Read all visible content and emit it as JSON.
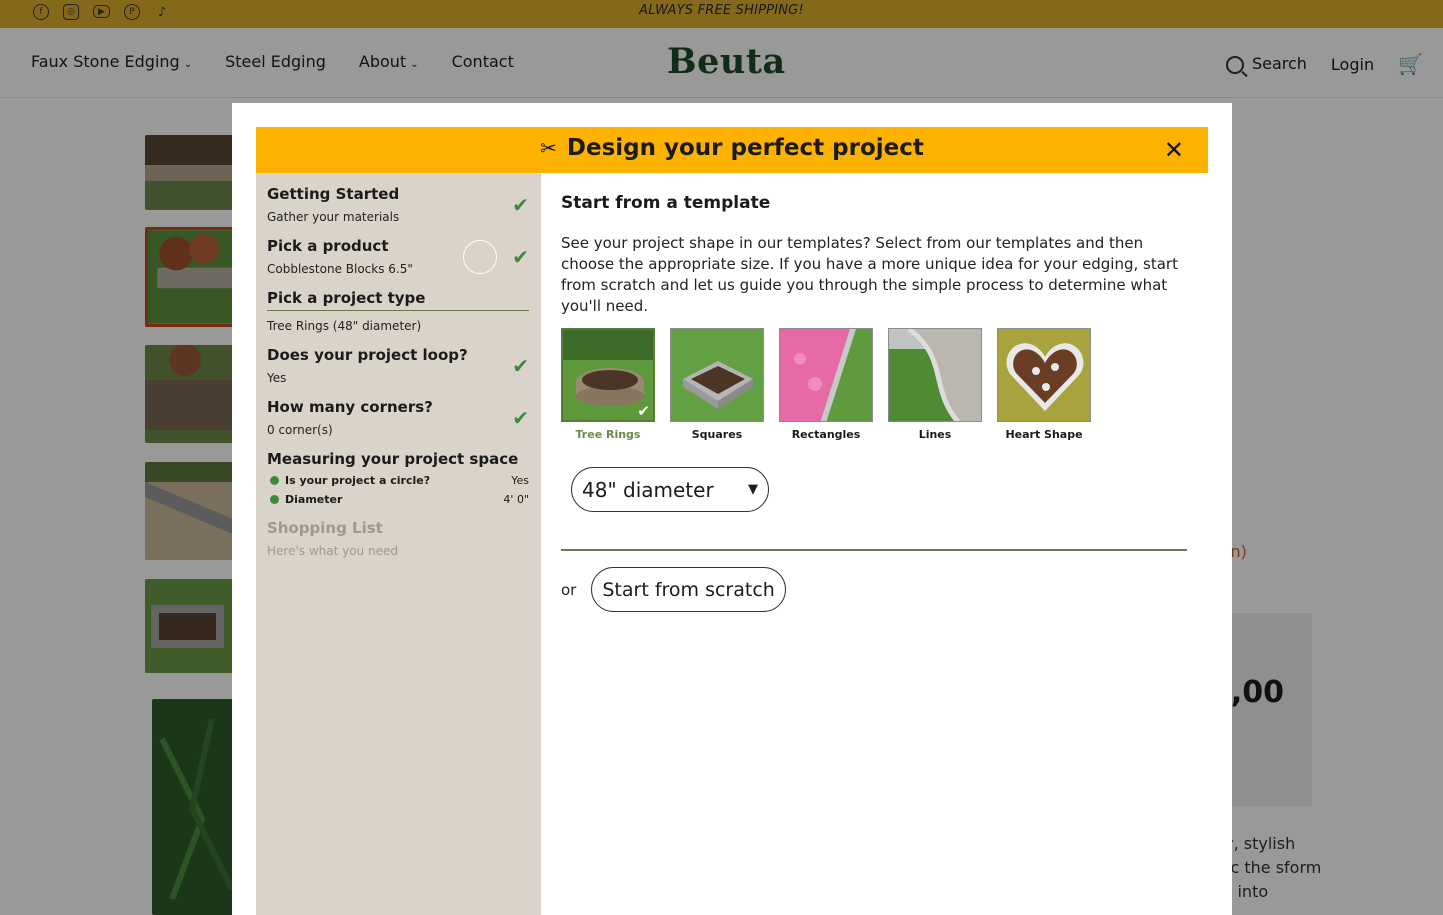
{
  "topbar": {
    "shipping": "ALWAYS FREE SHIPPING!",
    "social_icons": [
      "facebook-icon",
      "instagram-icon",
      "youtube-icon",
      "pinterest-icon",
      "tiktok-icon"
    ]
  },
  "header": {
    "nav": [
      {
        "label": "Faux Stone Edging",
        "has_menu": true
      },
      {
        "label": "Steel Edging",
        "has_menu": false
      },
      {
        "label": "About",
        "has_menu": true
      },
      {
        "label": "Contact",
        "has_menu": false
      }
    ],
    "logo": "Beuta",
    "search_label": "Search",
    "login_label": "Login"
  },
  "background": {
    "link_fragment": "in)",
    "price_fragment": ",00",
    "text_fragment": "asy, stylish imic the sform cks into"
  },
  "modal": {
    "title": "Design your perfect project",
    "close_label": "✕",
    "steps": [
      {
        "title": "Getting Started",
        "value": "Gather your materials",
        "done": true
      },
      {
        "title": "Pick a product",
        "value": "Cobblestone Blocks 6.5\"",
        "done": true
      },
      {
        "title": "Pick a project type",
        "value": "Tree Rings (48\" diameter)",
        "active": true
      },
      {
        "title": "Does your project loop?",
        "value": "Yes",
        "done": true
      },
      {
        "title": "How many corners?",
        "value": "0 corner(s)",
        "done": true
      },
      {
        "title": "Measuring your project space",
        "sub": [
          {
            "label": "Is your project a circle?",
            "value": "Yes"
          },
          {
            "label": "Diameter",
            "value": "4' 0\""
          }
        ]
      },
      {
        "title": "Shopping List",
        "value": "Here's what you need",
        "disabled": true
      }
    ],
    "content": {
      "heading": "Start from a template",
      "description": "See your project shape in our templates? Select from our templates and then choose the appropriate size. If you have a more unique idea for your edging, start from scratch and let us guide you through the simple process to determine what you'll need.",
      "templates": [
        {
          "label": "Tree Rings",
          "selected": true
        },
        {
          "label": "Squares"
        },
        {
          "label": "Rectangles"
        },
        {
          "label": "Lines"
        },
        {
          "label": "Heart Shape"
        }
      ],
      "size_value": "48\" diameter",
      "or_label": "or",
      "scratch_label": "Start from scratch"
    }
  }
}
